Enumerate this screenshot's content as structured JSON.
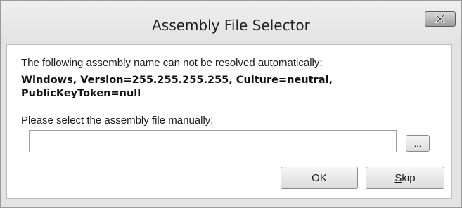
{
  "window": {
    "title": "Assembly File Selector",
    "close_icon": "close-icon"
  },
  "message": {
    "line1": "The following assembly name can not be resolved automatically:",
    "assembly_line1": "Windows, Version=255.255.255.255, Culture=neutral,",
    "assembly_line2": "PublicKeyToken=null",
    "prompt": "Please select the assembly file manually:"
  },
  "file_input": {
    "value": "",
    "placeholder": ""
  },
  "buttons": {
    "browse_label": "...",
    "ok_label": "OK",
    "skip_mnemonic": "S",
    "skip_rest": "kip"
  }
}
